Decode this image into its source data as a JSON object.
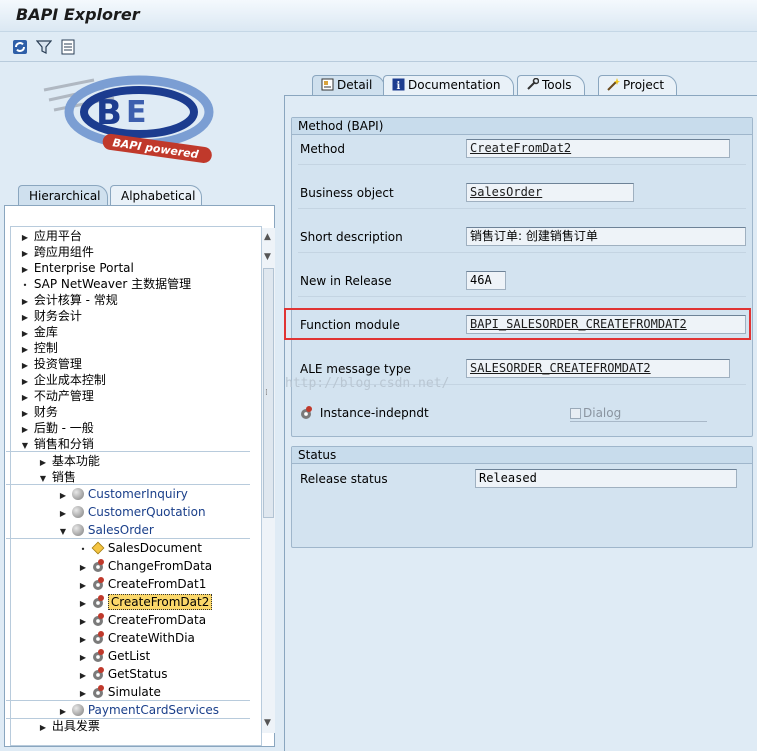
{
  "window": {
    "title": "BAPI Explorer"
  },
  "toolbar": {
    "icons": [
      "refresh-icon",
      "filter-icon",
      "list-icon"
    ]
  },
  "logo": {
    "text": "BAPI powered"
  },
  "left_tabs": [
    {
      "label": "Hierarchical",
      "active": true
    },
    {
      "label": "Alphabetical",
      "active": false
    }
  ],
  "tree": {
    "top_items": [
      "应用平台",
      "跨应用组件",
      "Enterprise Portal",
      "SAP NetWeaver 主数据管理",
      "会计核算 - 常规",
      "财务会计",
      "金库",
      "控制",
      "投资管理",
      "企业成本控制",
      "不动产管理",
      "财务",
      "后勤 - 一般",
      "销售和分销"
    ],
    "sd_children": [
      "基本功能",
      "销售"
    ],
    "sales_objects": [
      "CustomerInquiry",
      "CustomerQuotation",
      "SalesOrder"
    ],
    "salesorder_children": [
      "SalesDocument",
      "ChangeFromData",
      "CreateFromDat1",
      "CreateFromDat2",
      "CreateFromData",
      "CreateWithDia",
      "GetList",
      "GetStatus",
      "Simulate"
    ],
    "after": [
      "PaymentCardServices"
    ],
    "bottom": "出具发票"
  },
  "right_tabs": [
    {
      "label": "Detail",
      "icon": "detail-icon",
      "active": true
    },
    {
      "label": "Documentation",
      "icon": "info-icon",
      "active": false
    },
    {
      "label": "Tools",
      "icon": "tools-icon",
      "active": false
    },
    {
      "label": "Project",
      "icon": "wand-icon",
      "active": false
    }
  ],
  "method_group": {
    "title": "Method (BAPI)",
    "method_label": "Method",
    "method_value": "CreateFromDat2",
    "bo_label": "Business object",
    "bo_value": "SalesOrder",
    "short_label": "Short description",
    "short_value": "销售订单: 创建销售订单",
    "release_label": "New in Release",
    "release_value": "46A",
    "fm_label": "Function module",
    "fm_value": "BAPI_SALESORDER_CREATEFROMDAT2",
    "ale_label": "ALE message type",
    "ale_value": "SALESORDER_CREATEFROMDAT2",
    "instance_label": "Instance-indepndt",
    "dialog_label": "Dialog"
  },
  "status_group": {
    "title": "Status",
    "release_status_label": "Release status",
    "release_status_value": "Released"
  },
  "watermark": "http://blog.csdn.net/",
  "colors": {
    "highlight": "#e03434",
    "selected": "#fbd86a",
    "link_blue": "#1a3f8a"
  }
}
